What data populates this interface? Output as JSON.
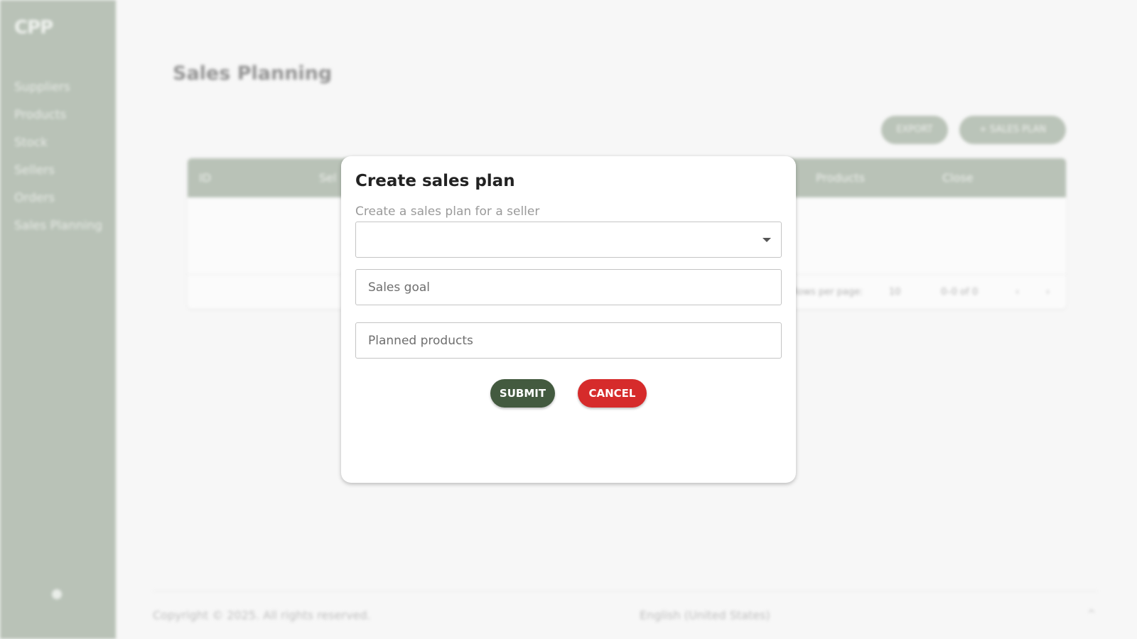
{
  "sidebar": {
    "logo": "CPP",
    "items": [
      {
        "label": "Suppliers"
      },
      {
        "label": "Products"
      },
      {
        "label": "Stock"
      },
      {
        "label": "Sellers"
      },
      {
        "label": "Orders"
      },
      {
        "label": "Sales Planning"
      }
    ]
  },
  "page": {
    "title": "Sales Planning",
    "export_label": "EXPORT",
    "sales_plan_label": "+ SALES PLAN"
  },
  "table": {
    "columns": [
      "ID",
      "Sel",
      "Products",
      "Close"
    ],
    "rows_per_page_label": "Rows per page:",
    "rows_per_page_value": "10",
    "pagination_text": "0–0 of 0"
  },
  "footer": {
    "copyright": "Copyright © 2025. All rights reserved.",
    "language": "English (United States)"
  },
  "modal": {
    "title": "Create sales plan",
    "subtitle": "Create a sales plan for a seller",
    "seller_select_value": "",
    "sales_goal_placeholder": "Sales goal",
    "planned_products_placeholder": "Planned products",
    "submit_label": "SUBMIT",
    "cancel_label": "CANCEL"
  },
  "colors": {
    "sidebar": "#b3bdb1",
    "submit": "#435a3f",
    "cancel": "#d62b2b"
  }
}
